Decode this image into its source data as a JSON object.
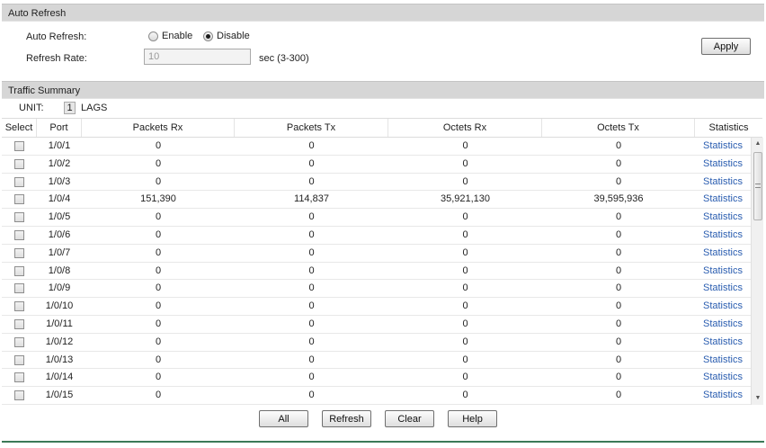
{
  "auto_refresh_section": {
    "title": "Auto Refresh",
    "auto_refresh_label": "Auto Refresh:",
    "enable_label": "Enable",
    "disable_label": "Disable",
    "selected": "disable",
    "refresh_rate_label": "Refresh Rate:",
    "refresh_rate_value": "10",
    "refresh_rate_hint": "sec (3-300)",
    "apply_label": "Apply"
  },
  "traffic_summary": {
    "title": "Traffic Summary",
    "unit_label": "UNIT:",
    "unit_value": "1",
    "lags_label": "LAGS",
    "columns": [
      "Select",
      "Port",
      "Packets Rx",
      "Packets Tx",
      "Octets Rx",
      "Octets Tx",
      "Statistics"
    ],
    "rows": [
      {
        "port": "1/0/1",
        "packets_rx": "0",
        "packets_tx": "0",
        "octets_rx": "0",
        "octets_tx": "0",
        "statistics": "Statistics"
      },
      {
        "port": "1/0/2",
        "packets_rx": "0",
        "packets_tx": "0",
        "octets_rx": "0",
        "octets_tx": "0",
        "statistics": "Statistics"
      },
      {
        "port": "1/0/3",
        "packets_rx": "0",
        "packets_tx": "0",
        "octets_rx": "0",
        "octets_tx": "0",
        "statistics": "Statistics"
      },
      {
        "port": "1/0/4",
        "packets_rx": "151,390",
        "packets_tx": "114,837",
        "octets_rx": "35,921,130",
        "octets_tx": "39,595,936",
        "statistics": "Statistics"
      },
      {
        "port": "1/0/5",
        "packets_rx": "0",
        "packets_tx": "0",
        "octets_rx": "0",
        "octets_tx": "0",
        "statistics": "Statistics"
      },
      {
        "port": "1/0/6",
        "packets_rx": "0",
        "packets_tx": "0",
        "octets_rx": "0",
        "octets_tx": "0",
        "statistics": "Statistics"
      },
      {
        "port": "1/0/7",
        "packets_rx": "0",
        "packets_tx": "0",
        "octets_rx": "0",
        "octets_tx": "0",
        "statistics": "Statistics"
      },
      {
        "port": "1/0/8",
        "packets_rx": "0",
        "packets_tx": "0",
        "octets_rx": "0",
        "octets_tx": "0",
        "statistics": "Statistics"
      },
      {
        "port": "1/0/9",
        "packets_rx": "0",
        "packets_tx": "0",
        "octets_rx": "0",
        "octets_tx": "0",
        "statistics": "Statistics"
      },
      {
        "port": "1/0/10",
        "packets_rx": "0",
        "packets_tx": "0",
        "octets_rx": "0",
        "octets_tx": "0",
        "statistics": "Statistics"
      },
      {
        "port": "1/0/11",
        "packets_rx": "0",
        "packets_tx": "0",
        "octets_rx": "0",
        "octets_tx": "0",
        "statistics": "Statistics"
      },
      {
        "port": "1/0/12",
        "packets_rx": "0",
        "packets_tx": "0",
        "octets_rx": "0",
        "octets_tx": "0",
        "statistics": "Statistics"
      },
      {
        "port": "1/0/13",
        "packets_rx": "0",
        "packets_tx": "0",
        "octets_rx": "0",
        "octets_tx": "0",
        "statistics": "Statistics"
      },
      {
        "port": "1/0/14",
        "packets_rx": "0",
        "packets_tx": "0",
        "octets_rx": "0",
        "octets_tx": "0",
        "statistics": "Statistics"
      },
      {
        "port": "1/0/15",
        "packets_rx": "0",
        "packets_tx": "0",
        "octets_rx": "0",
        "octets_tx": "0",
        "statistics": "Statistics"
      }
    ]
  },
  "buttons": {
    "all": "All",
    "refresh": "Refresh",
    "clear": "Clear",
    "help": "Help"
  },
  "colors": {
    "header_bg": "#d6d6d6",
    "link": "#2a5db0",
    "footer_line": "#3b7a57"
  }
}
